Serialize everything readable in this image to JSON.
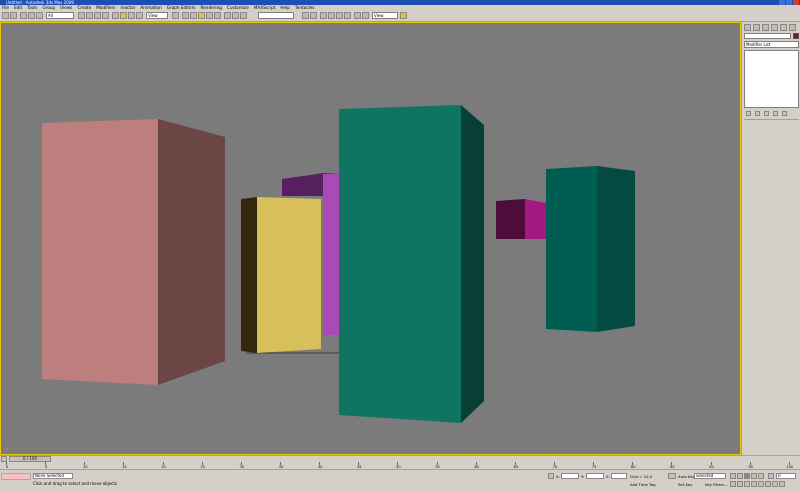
{
  "app": {
    "title": "Untitled - Autodesk 3ds Max 2009"
  },
  "menu": [
    "File",
    "Edit",
    "Tools",
    "Group",
    "Views",
    "Create",
    "Modifiers",
    "reactor",
    "Animation",
    "Graph Editors",
    "Rendering",
    "Customize",
    "MAXScript",
    "Help",
    "Tentacles"
  ],
  "toolbar": {
    "selection_filter": "All",
    "ref_coord": "View",
    "named_selection": ""
  },
  "viewport": {
    "label": "",
    "axis": "z",
    "colors": {
      "background": "#7b7b7b",
      "pink_front": "#bd7f7d",
      "pink_side": "#6b4645",
      "teal_front": "#0f7462",
      "teal_side": "#073f36",
      "yellow_front": "#d7bf5a",
      "yellow_side": "#33280d",
      "purple_top": "#56205e",
      "purple_side": "#a94ab7",
      "magenta_front": "#a41883",
      "magenta_side": "#4d0c3a",
      "dark_teal_front": "#005d52",
      "dark_teal_side": "#044a40"
    }
  },
  "command_panel": {
    "modifier_list": "Modifier List"
  },
  "timeline": {
    "slider": "0 / 100",
    "ticks": [
      "0",
      "5",
      "10",
      "15",
      "20",
      "25",
      "30",
      "35",
      "40",
      "45",
      "50",
      "55",
      "60",
      "65",
      "70",
      "75",
      "80",
      "85",
      "90",
      "95",
      "100"
    ]
  },
  "status": {
    "selection": "None Selected",
    "prompt": "Click and drag to select and move objects",
    "x_label": "X:",
    "y_label": "Y:",
    "z_label": "Z:",
    "grid": "Grid = 10.0",
    "add_time_tag": "Add Time Tag",
    "auto_key": "Auto Key",
    "auto_key_value": "Selected",
    "set_key": "Set Key",
    "key_filters": "Key Filters...",
    "frame": "0"
  }
}
